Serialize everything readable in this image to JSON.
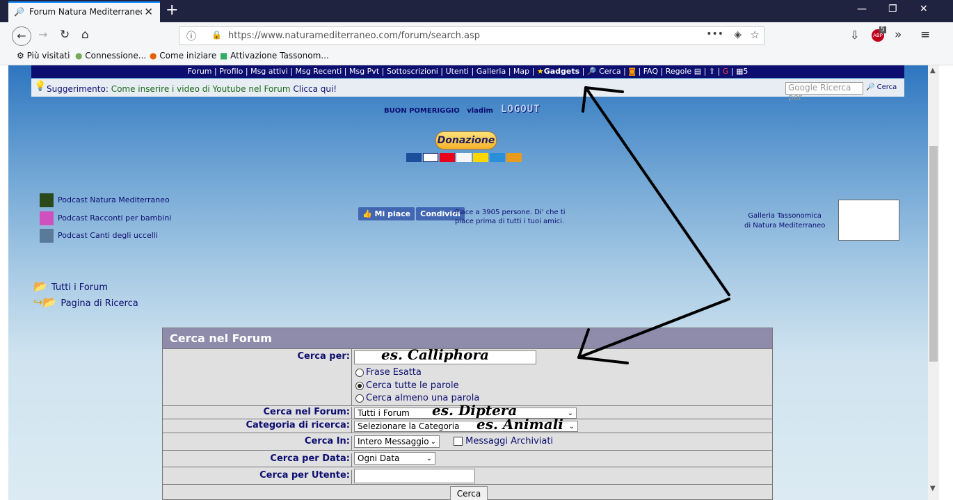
{
  "browser": {
    "tab_title": "Forum Natura Mediterraneo - F",
    "url": "https://www.naturamediterraneo.com/forum/search.asp",
    "badge_count": "5",
    "bookmarks": [
      "Più visitati",
      "Connessione...",
      "Come iniziare",
      "Attivazione Tassonom..."
    ]
  },
  "site": {
    "nav_items": [
      "Forum",
      "Profilo",
      "Msg attivi",
      "Msg Recenti",
      "Msg Pvt",
      "Sottoscrizioni",
      "Utenti",
      "Galleria",
      "Map",
      "Gadgets",
      "Cerca",
      "FAQ",
      "Regole"
    ],
    "nav_extra": "5",
    "suggest_prefix": "Suggerimento:",
    "suggest_text": "Come inserire i video di Youtube nel Forum",
    "suggest_link": "Clicca qui!",
    "google_placeholder": "Google Ricerca per",
    "google_button": "Cerca",
    "greeting": "BUON POMERIGGIO",
    "username": "vladim",
    "logout": "LOGOUT",
    "donate": "Donazione",
    "podcasts": [
      "Podcast Natura Mediterraneo",
      "Podcast Racconti per bambini",
      "Podcast Canti degli uccelli"
    ],
    "fb_like": "Mi piace",
    "fb_share": "Condividi",
    "fb_text": "Piace a 3905 persone. Di' che ti piace prima di tutti i tuoi amici.",
    "gallery_line1": "Galleria Tassonomica",
    "gallery_line2": "di Natura Mediterraneo",
    "all_forums": "Tutti i Forum",
    "search_page": "Pagina di Ricerca"
  },
  "form": {
    "title": "Cerca nel Forum",
    "search_for_label": "Cerca per:",
    "radio_options": [
      "Frase Esatta",
      "Cerca tutte le parole",
      "Cerca almeno una parola"
    ],
    "forum_label": "Cerca nel Forum:",
    "forum_value": "Tutti i Forum",
    "category_label": "Categoria di ricerca:",
    "category_value": "Selezionare la Categoria",
    "search_in_label": "Cerca In:",
    "search_in_value": "Intero Messaggio",
    "archived_label": "Messaggi Archiviati",
    "date_label": "Cerca per Data:",
    "date_value": "Ogni Data",
    "user_label": "Cerca per Utente:",
    "submit": "Cerca"
  },
  "annotations": {
    "example1": "es. Calliphora",
    "example2": "es.    Diptera",
    "example3": "es. Animali"
  }
}
